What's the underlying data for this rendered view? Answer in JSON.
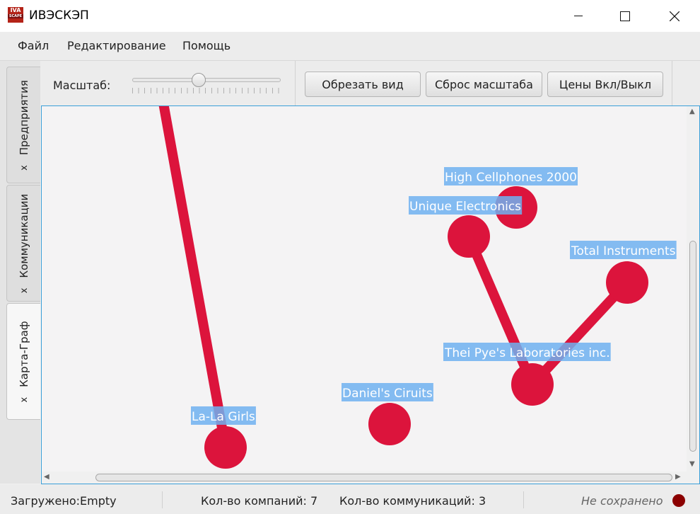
{
  "window": {
    "title": "ИВЭСКЭП",
    "logo_text_top": "IVA",
    "logo_text_bottom": "SCAPE"
  },
  "menu": {
    "items": [
      "Файл",
      "Редактирование",
      "Помощь"
    ]
  },
  "side_tabs": [
    {
      "label": "Предприятия",
      "close": "x"
    },
    {
      "label": "Коммуникации",
      "close": "x"
    },
    {
      "label": "Карта-Граф",
      "close": "x",
      "active": true
    }
  ],
  "toolbar": {
    "zoom_label": "Масштаб:",
    "zoom_level": 0.45,
    "crop_button": "Обрезать вид",
    "reset_button": "Сброс масштаба",
    "prices_button": "Цены Вкл/Выкл"
  },
  "graph": {
    "node_color": "#dc143c",
    "label_bg": "#6fb0f0",
    "nodes": [
      {
        "id": "lala",
        "label": "La-La Girls"
      },
      {
        "id": "daniels",
        "label": "Daniel's Ciruits"
      },
      {
        "id": "high",
        "label": "High Cellphones 2000"
      },
      {
        "id": "unique",
        "label": "Unique Electronics"
      },
      {
        "id": "total",
        "label": "Total Instruments"
      },
      {
        "id": "thei",
        "label": "Thei Pye's Laboratories inc."
      }
    ],
    "edges": [
      {
        "from": "offscreen-top",
        "to": "lala"
      },
      {
        "from": "unique",
        "to": "thei"
      },
      {
        "from": "total",
        "to": "thei"
      }
    ]
  },
  "status": {
    "loaded": "Загружено:Empty",
    "companies": "Кол-во компаний: 7",
    "communications": "Кол-во коммуникаций: 3",
    "unsaved": "Не сохранено",
    "indicator_color": "#8b0000"
  }
}
